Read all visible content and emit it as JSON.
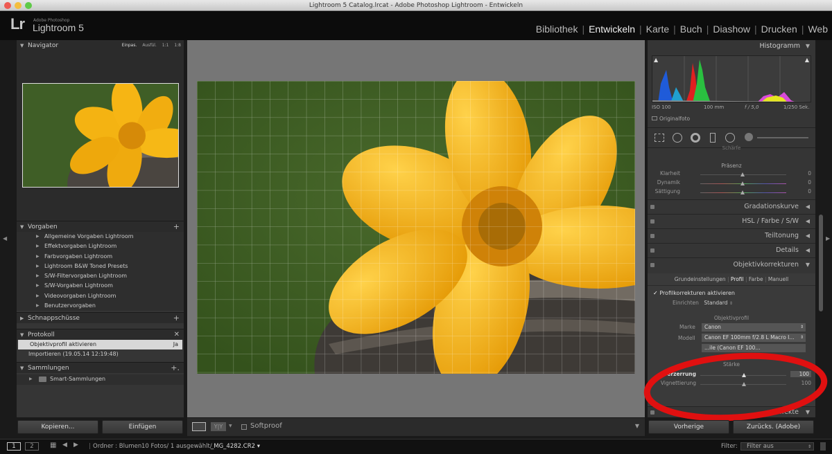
{
  "window": {
    "title": "Lightroom 5 Catalog.lrcat - Adobe Photoshop Lightroom - Entwickeln"
  },
  "brand": {
    "logo": "Lr",
    "line1": "Adobe Photoshop",
    "line2": "Lightroom 5"
  },
  "modules": [
    "Bibliothek",
    "Entwickeln",
    "Karte",
    "Buch",
    "Diashow",
    "Drucken",
    "Web"
  ],
  "active_module": "Entwickeln",
  "navigator": {
    "title": "Navigator",
    "zoom": [
      "Einpas.",
      "Ausfül.",
      "1:1",
      "1:8"
    ]
  },
  "presets": {
    "title": "Vorgaben",
    "items": [
      "Allgemeine Vorgaben Lightroom",
      "Effektvorgaben Lightroom",
      "Farbvorgaben Lightroom",
      "Lightroom B&W Toned Presets",
      "S/W-Filtervorgaben Lightroom",
      "S/W-Vorgaben Lightroom",
      "Videovorgaben Lightroom",
      "Benutzervorgaben"
    ]
  },
  "snapshots": {
    "title": "Schnappschüsse"
  },
  "history": {
    "title": "Protokoll",
    "items": [
      {
        "label": "Objektivprofil aktivieren",
        "value": "Ja"
      },
      {
        "label": "Importieren (19.05.14 12:19:48)",
        "value": ""
      }
    ]
  },
  "collections": {
    "title": "Sammlungen",
    "items": [
      "Smart-Sammlungen"
    ]
  },
  "left_buttons": {
    "copy": "Kopieren...",
    "paste": "Einfügen"
  },
  "toolbar": {
    "softproof": "Softproof"
  },
  "histogram": {
    "title": "Histogramm",
    "iso": "ISO 100",
    "focal": "100 mm",
    "aperture": "f / 5,0",
    "shutter_num": "1",
    "shutter_den": "250",
    "shutter_unit": " Sek.",
    "original": "Originalfoto"
  },
  "presence": {
    "cut_label": "Schärfe",
    "title": "Präsenz",
    "sliders": [
      {
        "label": "Klarheit",
        "value": "0"
      },
      {
        "label": "Dynamik",
        "value": "0"
      },
      {
        "label": "Sättigung",
        "value": "0"
      }
    ]
  },
  "sections": [
    "Gradationskurve",
    "HSL  /  Farbe  /  S/W",
    "Teiltonung",
    "Details",
    "Objektivkorrekturen"
  ],
  "lens": {
    "tabs": [
      "Grundeinstellungen",
      "Profil",
      "Farbe",
      "Manuell"
    ],
    "active_tab": "Profil",
    "enable_label": "Profilkorrekturen aktivieren",
    "setup_label": "Einrichten",
    "setup_value": "Standard",
    "profile_title": "Objektivprofil",
    "make_label": "Marke",
    "make_value": "Canon",
    "model_label": "Modell",
    "model_value": "Canon EF 100mm f/2.8 L Macro I...",
    "profile_hidden": "...ile (Canon EF 100...",
    "amount_title": "Stärke",
    "distortion_label": "Verzerrung",
    "distortion_value": "100",
    "vignetting_label": "Vignettierung",
    "vignetting_value": "100"
  },
  "effects_cut": "...ffekte",
  "right_buttons": {
    "previous": "Vorherige",
    "reset": "Zurücks. (Adobe)"
  },
  "filmstrip": {
    "folder": "Ordner : Blumen",
    "count": "10 Fotos/ 1 ausgewählt/",
    "file": "_MG_4282.CR2",
    "filter_label": "Filter:",
    "filter_value": "Filter aus",
    "page1": "1",
    "page2": "2"
  },
  "colors": {
    "accent_red": "#e01010",
    "panel": "#353535",
    "background": "#1a1a1a"
  }
}
